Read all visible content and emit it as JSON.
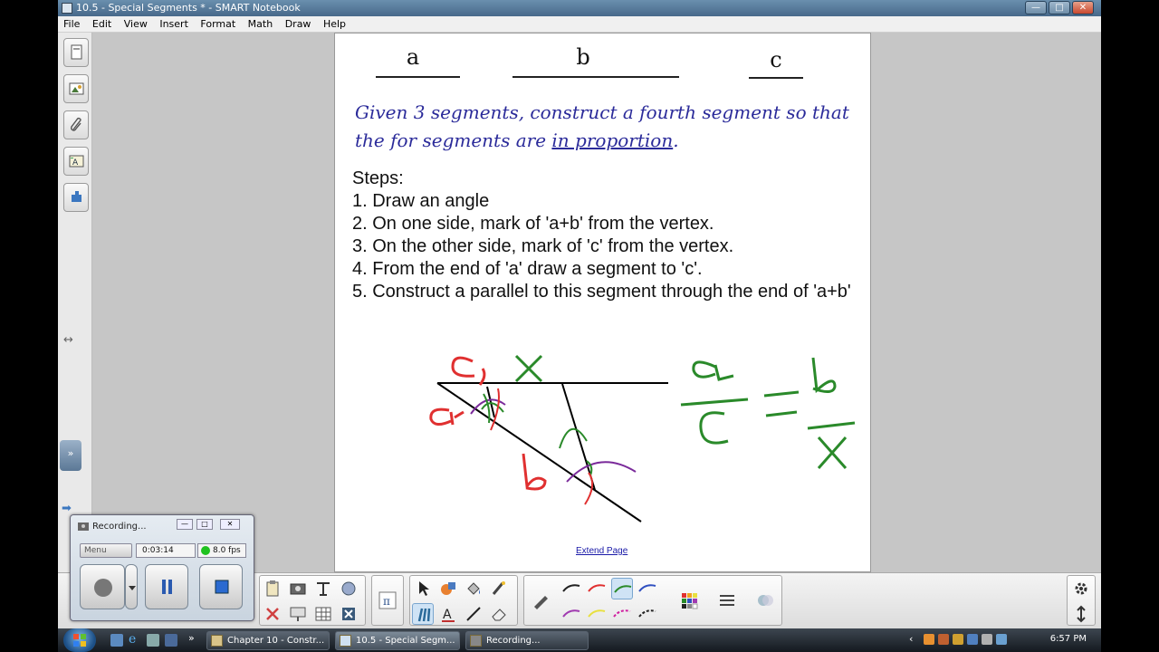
{
  "window": {
    "title": "10.5 - Special Segments * - SMART Notebook",
    "controls": {
      "minimize": "—",
      "maximize": "□",
      "close": "✕"
    }
  },
  "menu": [
    "File",
    "Edit",
    "View",
    "Insert",
    "Format",
    "Math",
    "Draw",
    "Help"
  ],
  "sidebar": {
    "tabs": [
      "page-sorter-icon",
      "gallery-icon",
      "attachments-icon",
      "properties-icon",
      "add-ons-icon"
    ]
  },
  "page": {
    "segments": [
      {
        "label": "a"
      },
      {
        "label": "b"
      },
      {
        "label": "c"
      }
    ],
    "prompt": {
      "before": "Given 3 segments, construct a fourth segment so that the for segments are ",
      "underlined": "in proportion",
      "after": "."
    },
    "steps_heading": "Steps:",
    "steps": [
      "1.  Draw an angle",
      "2.  On one side, mark of 'a+b' from the vertex.",
      "3.  On the other side, mark of 'c' from the vertex.",
      "4.  From the end of 'a' draw a segment to 'c'.",
      "5.  Construct a parallel to this segment through the end of 'a+b'"
    ],
    "extend_link": "Extend Page",
    "ink_colors": {
      "red": "#e03030",
      "green": "#2a8a2a",
      "purple": "#7a2a9a",
      "black": "#000000"
    }
  },
  "recorder": {
    "title": "Recording...",
    "menu_label": "Menu",
    "elapsed": "0:03:14",
    "fps": "8.0 fps"
  },
  "taskbar": {
    "tasks": [
      {
        "label": "Chapter 10 - Constr...",
        "active": false
      },
      {
        "label": "10.5 - Special Segm...",
        "active": true
      },
      {
        "label": "Recording...",
        "active": false
      }
    ],
    "overflow": "»",
    "clock": "6:57 PM"
  }
}
